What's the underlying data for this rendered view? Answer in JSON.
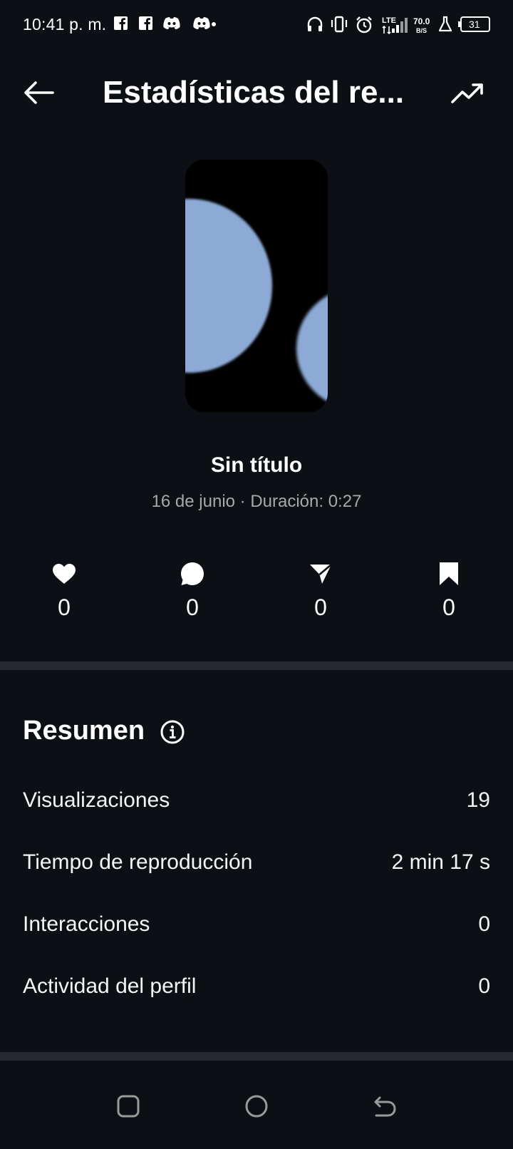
{
  "status_bar": {
    "time": "10:41 p. m.",
    "network": "LTE",
    "speed_value": "70.0",
    "speed_unit": "B/S",
    "battery": "31",
    "icons": [
      "facebook-icon",
      "facebook-icon",
      "discord-icon",
      "discord-icon",
      "headphones-icon",
      "vibrate-icon",
      "alarm-icon",
      "lte-signal-icon",
      "signal-icon",
      "flask-icon",
      "battery-icon"
    ]
  },
  "header": {
    "title": "Estadísticas del re...",
    "back_icon": "back-arrow-icon",
    "trend_icon": "trending-up-icon"
  },
  "reel": {
    "title": "Sin título",
    "meta": "16 de junio · Duración: 0:27"
  },
  "engagement": [
    {
      "icon": "heart-icon",
      "count": "0"
    },
    {
      "icon": "comment-icon",
      "count": "0"
    },
    {
      "icon": "send-icon",
      "count": "0"
    },
    {
      "icon": "bookmark-icon",
      "count": "0"
    }
  ],
  "summary": {
    "heading": "Resumen",
    "rows": [
      {
        "label": "Visualizaciones",
        "value": "19"
      },
      {
        "label": "Tiempo de reproducción",
        "value": "2 min 17 s"
      },
      {
        "label": "Interacciones",
        "value": "0"
      },
      {
        "label": "Actividad del perfil",
        "value": "0"
      }
    ]
  },
  "colors": {
    "background": "#0c1014",
    "divider": "#262a2e",
    "secondary_text": "#a8a8a8",
    "thumbnail_shape": "#8daad6"
  }
}
